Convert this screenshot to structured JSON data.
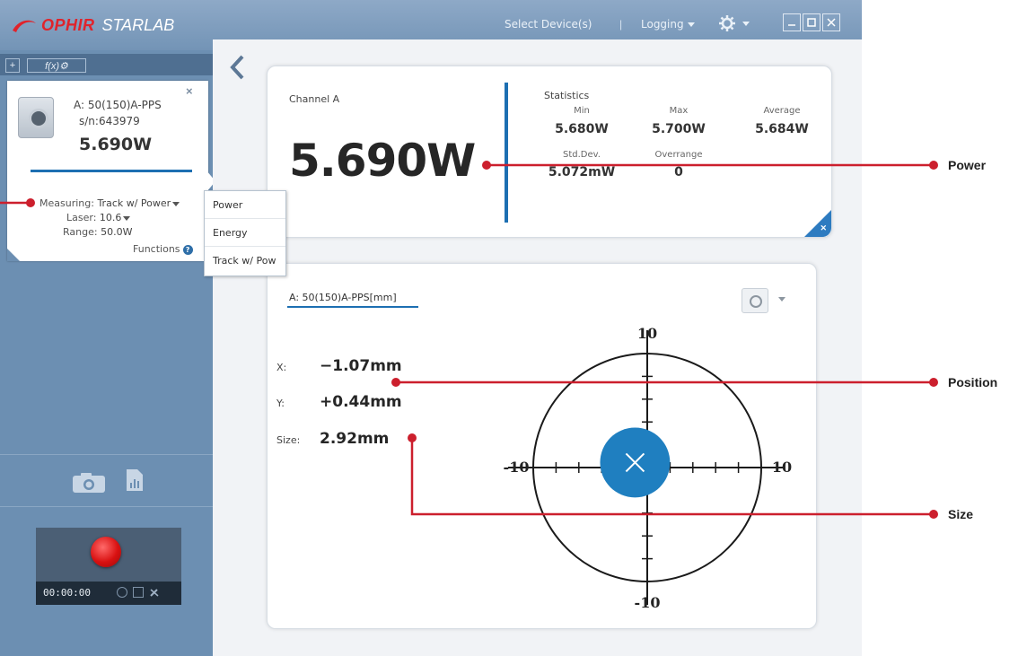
{
  "app": {
    "brand": "OPHIR",
    "product": "STARLAB",
    "menu": {
      "select_devices": "Select Device(s)",
      "separator": "|",
      "logging": "Logging"
    }
  },
  "sidebar": {
    "toolbar": {
      "add": "+",
      "function": "f(x)⚙"
    },
    "device": {
      "name": "A: 50(150)A-PPS",
      "serial": "s/n:643979",
      "reading": "5.690W",
      "close": "×",
      "measuring_label": "Measuring:",
      "measuring_value": "Track w/ Power",
      "laser_label": "Laser:",
      "laser_value": "10.6",
      "range_label": "Range:",
      "range_value": "50.0W",
      "functions_label": "Functions"
    },
    "measure_menu": [
      "Power",
      "Energy",
      "Track w/ Pow"
    ],
    "recording": {
      "time": "00:00:00"
    }
  },
  "power_panel": {
    "channel": "Channel A",
    "reading": "5.690W",
    "statistics_title": "Statistics",
    "stats": {
      "min_label": "Min",
      "min_value": "5.680W",
      "max_label": "Max",
      "max_value": "5.700W",
      "avg_label": "Average",
      "avg_value": "5.684W",
      "std_label": "Std.Dev.",
      "std_value": "5.072mW",
      "over_label": "Overrange",
      "over_value": "0"
    }
  },
  "position_panel": {
    "title": "A: 50(150)A-PPS[mm]",
    "x_label": "X:",
    "x_value": "−1.07mm",
    "y_label": "Y:",
    "y_value": "+0.44mm",
    "size_label": "Size:",
    "size_value": "2.92mm",
    "axis": {
      "top": "10",
      "bottom": "-10",
      "left": "-10",
      "right": "10"
    },
    "axis_range": [
      -10,
      10
    ],
    "beam": {
      "x_mm": -1.07,
      "y_mm": 0.44,
      "size_mm": 2.92
    }
  },
  "callouts": {
    "power": "Power",
    "position": "Position",
    "size": "Size"
  },
  "colors": {
    "accent_blue": "#1d6fb2",
    "beam_blue": "#1f7fc0",
    "callout_red": "#cc1f2d",
    "record_red": "#d91111"
  }
}
